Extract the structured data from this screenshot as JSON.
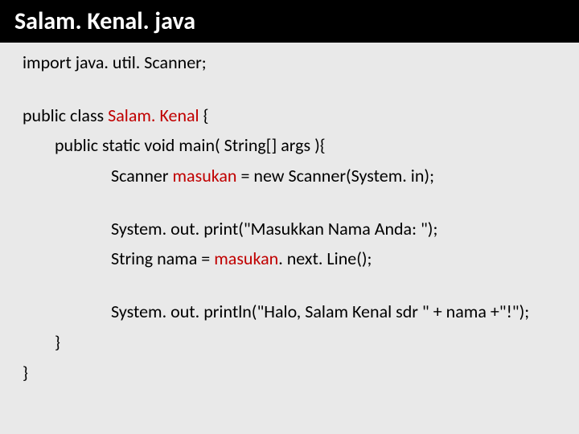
{
  "title": "Salam. Kenal. java",
  "code": {
    "l01": "import java. util. Scanner;",
    "l02a": "public class ",
    "l02b": "Salam. Kenal",
    "l02c": " {",
    "l03": "public static void main( String[] args ){",
    "l04a": "Scanner ",
    "l04b": "masukan",
    "l04c": " = new Scanner(System. in);",
    "l05": "System. out. print(\"Masukkan Nama Anda: \");",
    "l06a": "String nama = ",
    "l06b": "masukan",
    "l06c": ". next. Line();",
    "l07": "System. out. println(\"Halo, Salam Kenal sdr \" + nama +\"!\");",
    "l08": "}",
    "l09": "}"
  }
}
